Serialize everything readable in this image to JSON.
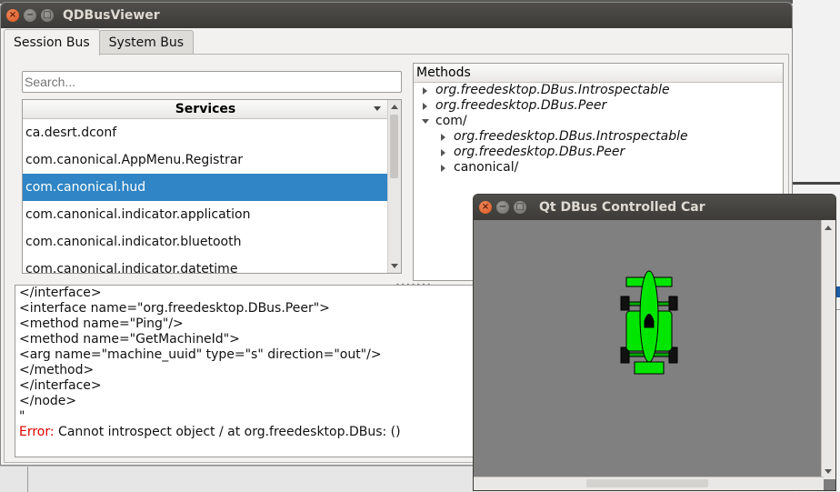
{
  "viewer": {
    "title": "QDBusViewer",
    "tabs": [
      "Session Bus",
      "System Bus"
    ],
    "search_placeholder": "Search...",
    "services_header": "Services",
    "services": [
      "ca.desrt.dconf",
      "com.canonical.AppMenu.Registrar",
      "com.canonical.hud",
      "com.canonical.indicator.application",
      "com.canonical.indicator.bluetooth",
      "com.canonical.indicator.datetime"
    ],
    "selected_service": "com.canonical.hud",
    "methods_header": "Methods",
    "methods_tree": [
      {
        "label": "org.freedesktop.DBus.Introspectable",
        "italic": true,
        "level": 0,
        "expanded": false
      },
      {
        "label": "org.freedesktop.DBus.Peer",
        "italic": true,
        "level": 0,
        "expanded": false
      },
      {
        "label": "com/",
        "italic": false,
        "level": 0,
        "expanded": true
      },
      {
        "label": "org.freedesktop.DBus.Introspectable",
        "italic": true,
        "level": 1,
        "expanded": false
      },
      {
        "label": "org.freedesktop.DBus.Peer",
        "italic": true,
        "level": 1,
        "expanded": false
      },
      {
        "label": "canonical/",
        "italic": false,
        "level": 1,
        "expanded": false
      }
    ],
    "output_lines": [
      "</interface>",
      "<interface name=\"org.freedesktop.DBus.Peer\">",
      "<method name=\"Ping\"/>",
      "<method name=\"GetMachineId\">",
      "<arg name=\"machine_uuid\" type=\"s\" direction=\"out\"/>",
      "</method>",
      "</interface>",
      "</node>",
      "\""
    ],
    "error_label": "Error:",
    "error_message": " Cannot introspect object / at org.freedesktop.DBus: ()"
  },
  "car_window": {
    "title": "Qt DBus Controlled Car",
    "body_color": "#00e600",
    "canvas_color": "#808080"
  }
}
